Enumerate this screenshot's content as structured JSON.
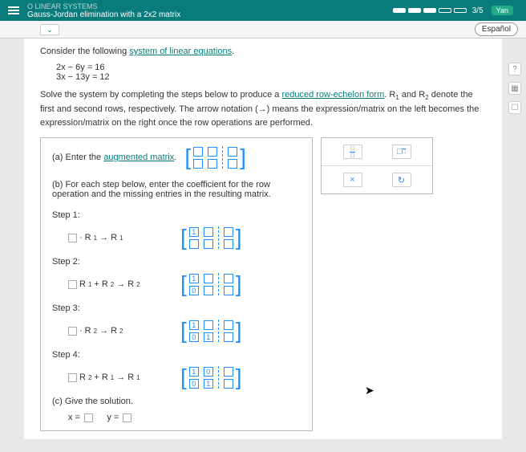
{
  "header": {
    "category": "O LINEAR SYSTEMS",
    "title": "Gauss-Jordan elimination with a 2x2 matrix",
    "progress": "3/5",
    "lang": "Español",
    "yan": "Yan"
  },
  "problem": {
    "intro_pre": "Consider the following ",
    "intro_link": "system of linear equations",
    "intro_post": ".",
    "eq1": "2x − 6y = 16",
    "eq2": "3x − 13y = 12",
    "inst_p1": "Solve the system by completing the steps below to produce a ",
    "inst_link": "reduced row-echelon form",
    "inst_p2": ". R",
    "inst_p3": " and R",
    "inst_p4": " denote the first and second rows, respectively. The arrow notation (→) means the expression/matrix on the left becomes the expression/matrix on the right once the row operations are performed."
  },
  "parts": {
    "a_pre": "(a) Enter the ",
    "a_link": "augmented matrix",
    "a_post": ".",
    "b": "(b) For each step below, enter the coefficient for the row operation and the missing entries in the resulting matrix.",
    "step1": "Step 1:",
    "step2": "Step 2:",
    "step3": "Step 3:",
    "step4": "Step 4:",
    "c": "(c) Give the solution.",
    "x_eq": "x =",
    "y_eq": "y ="
  },
  "ops": {
    "s1_sub1": "1",
    "s1_sub2": "1",
    "s2_sub1": "1",
    "s2_sub2": "2",
    "s2_sub3": "2",
    "s3_sub1": "2",
    "s3_sub2": "2",
    "s4_sub1": "2",
    "s4_sub2": "1",
    "s4_sub3": "1",
    "R": "R",
    "plus": "+",
    "arrow": "→",
    "dot": "·"
  },
  "mat": {
    "one": "1",
    "zero": "0"
  },
  "helper": {
    "frac_t": "□",
    "frac_b": "□",
    "repeat": "□",
    "x": "×",
    "undo": "↻"
  },
  "icons": {
    "q": "?",
    "calc": "▦",
    "sq": "☐"
  }
}
